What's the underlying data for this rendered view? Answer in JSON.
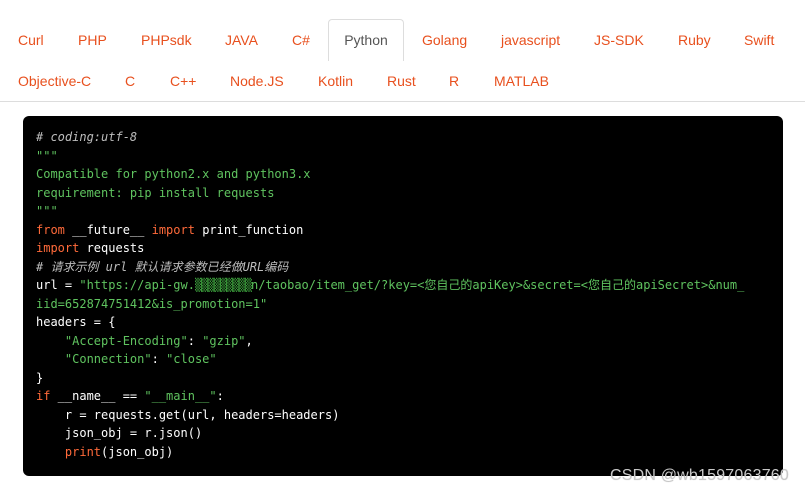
{
  "tabs": {
    "row1": [
      "Curl",
      "PHP",
      "PHPsdk",
      "JAVA",
      "C#",
      "Python",
      "Golang",
      "javascript",
      "JS-SDK",
      "Ruby",
      "Swift"
    ],
    "row2": [
      "Objective-C",
      "C",
      "C++",
      "Node.JS",
      "Kotlin",
      "Rust",
      "R",
      "MATLAB"
    ],
    "active": "Python"
  },
  "code": {
    "l1": "# coding:utf-8",
    "l2": "\"\"\"",
    "l3": "Compatible for python2.x and python3.x",
    "l4": "requirement: pip install requests",
    "l5": "\"\"\"",
    "l6_kw1": "from",
    "l6_a": " __future__ ",
    "l6_kw2": "import",
    "l6_b": " print_function",
    "l7_kw": "import",
    "l7_a": " requests",
    "l8": "# 请求示例 url 默认请求参数已经做URL编码",
    "l9_a": "url = ",
    "l9_s1": "\"https://api-gw.",
    "l9_s2": "n/taobao/item_get/?key=<您自己的apiKey>&secret=<您自己的apiSecret>&num_",
    "l10": "iid=652874751412&is_promotion=1\"",
    "l11": "headers = {",
    "l12_s1": "\"Accept-Encoding\"",
    "l12_a": ": ",
    "l12_s2": "\"gzip\"",
    "l12_b": ",",
    "l13_s1": "\"Connection\"",
    "l13_a": ": ",
    "l13_s2": "\"close\"",
    "l14": "}",
    "l15_kw": "if",
    "l15_a": " __name__ == ",
    "l15_s": "\"__main__\"",
    "l15_b": ":",
    "l16": "    r = requests.get(url, headers=headers)",
    "l17": "    json_obj = r.json()",
    "l18_kw": "print",
    "l18_a": "(json_obj)"
  },
  "watermark": "CSDN @wb1597063760",
  "colors": {
    "tab_text": "#e8501e",
    "code_bg": "#000000",
    "string": "#5fc35f",
    "keyword": "#ff6a3a",
    "comment": "#bdbdbd"
  }
}
